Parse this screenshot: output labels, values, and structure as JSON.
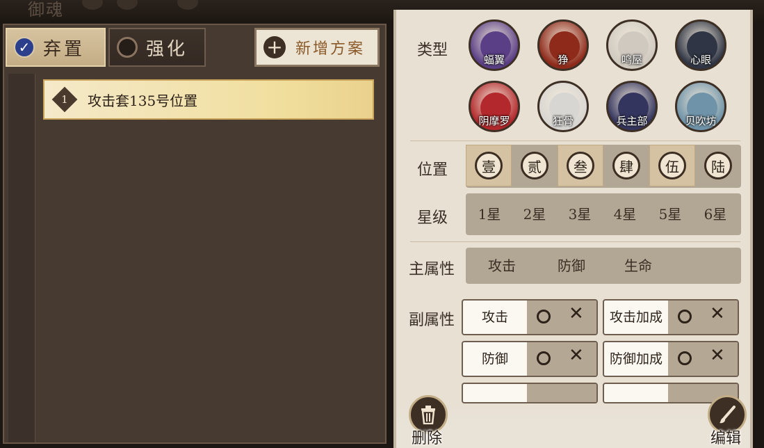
{
  "header": {
    "title": "御魂"
  },
  "tabs": [
    {
      "label": "弃置",
      "selected": true
    },
    {
      "label": "强化",
      "selected": false
    }
  ],
  "add_plan": {
    "label": "新增方案"
  },
  "plans": [
    {
      "number": "1",
      "name": "攻击套135号位置"
    }
  ],
  "filters": {
    "type_label": "类型",
    "types": [
      {
        "name": "蝠翼",
        "color": "#5a3f86",
        "icon": "bat-wing-portrait"
      },
      {
        "name": "狰",
        "color": "#8e2a1a",
        "icon": "zheng-portrait"
      },
      {
        "name": "鸣屋",
        "color": "#cfc9c0",
        "icon": "ming-wu-portrait"
      },
      {
        "name": "心眼",
        "color": "#2f3544",
        "icon": "xin-yan-portrait"
      },
      {
        "name": "阴摩罗",
        "color": "#b3282c",
        "icon": "yin-mo-luo-portrait"
      },
      {
        "name": "狂骨",
        "color": "#d8d6d2",
        "icon": "kuang-gu-portrait"
      },
      {
        "name": "兵主部",
        "color": "#34355e",
        "icon": "bing-zhu-bu-portrait"
      },
      {
        "name": "贝吹坊",
        "color": "#6f93a8",
        "icon": "bei-chui-fang-portrait"
      }
    ],
    "position_label": "位置",
    "positions": [
      {
        "label": "壹",
        "selected": true
      },
      {
        "label": "贰",
        "selected": false
      },
      {
        "label": "叁",
        "selected": true
      },
      {
        "label": "肆",
        "selected": false
      },
      {
        "label": "伍",
        "selected": true
      },
      {
        "label": "陆",
        "selected": false
      }
    ],
    "star_label": "星级",
    "stars": [
      "1星",
      "2星",
      "3星",
      "4星",
      "5星",
      "6星"
    ],
    "main_attr_label": "主属性",
    "main_attrs": [
      "攻击",
      "防御",
      "生命"
    ],
    "sub_attr_label": "副属性",
    "sub_attrs": [
      {
        "name": "攻击"
      },
      {
        "name": "攻击加成"
      },
      {
        "name": "防御"
      },
      {
        "name": "防御加成"
      }
    ]
  },
  "actions": {
    "delete_label": "删除",
    "edit_label": "编辑"
  }
}
